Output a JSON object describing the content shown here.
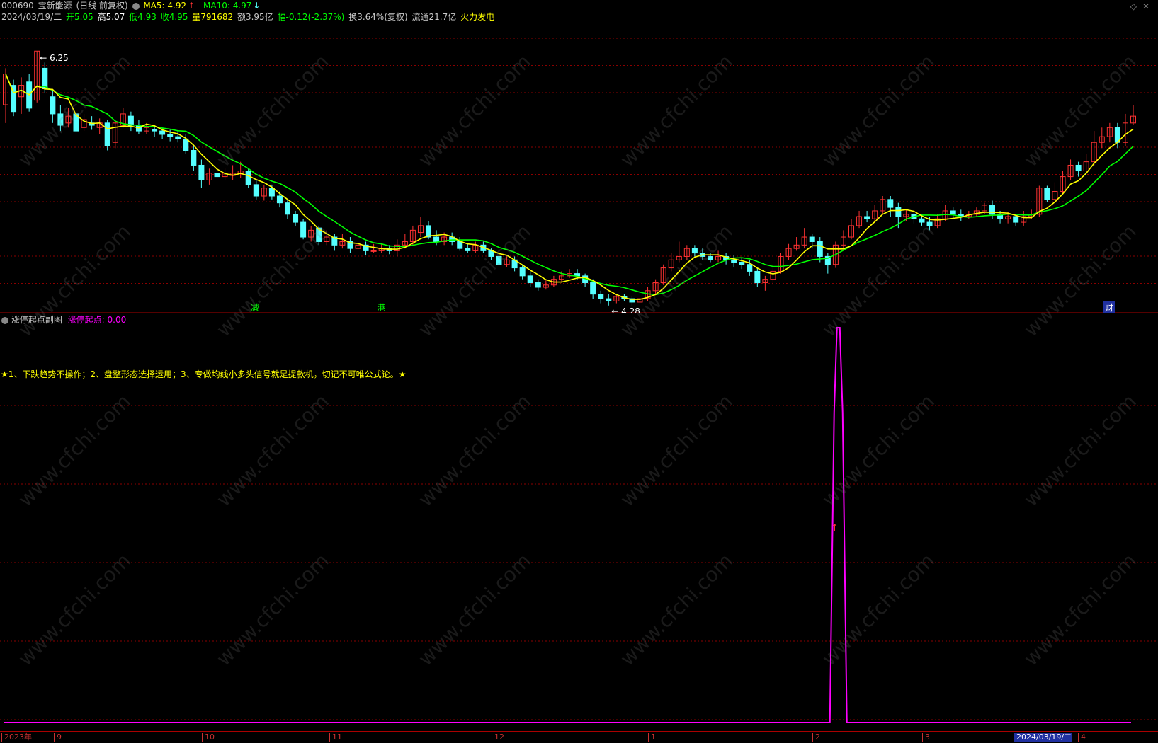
{
  "header": {
    "code": "000690",
    "name": "宝新能源",
    "mode": "(日线 前复权)",
    "ma5_label": "MA5: 4.92",
    "ma5_arrow": "↑",
    "ma10_label": "MA10: 4.97",
    "ma10_arrow": "↓"
  },
  "info": {
    "date": "2024/03/19/二",
    "open": "开5.05",
    "high": "高5.07",
    "low": "低4.93",
    "close": "收4.95",
    "volume": "量791682",
    "amount": "额3.95亿",
    "change": "幅-0.12(-2.37%)",
    "turnover": "换3.64%(复权)",
    "float": "流通21.7亿",
    "sector": "火力发电"
  },
  "main": {
    "high_label": "6.25",
    "low_label": "4.28",
    "markers": [
      "减",
      "港",
      "财"
    ]
  },
  "sub": {
    "name": "涨停起点副图",
    "indicator": "涨停起点: 0.00",
    "note": "★1、下跌趋势不操作；2、盘整形态选择运用；3、专做均线小多头信号就是提款机，切记不可唯公式论。★",
    "signal_arrow": "↑"
  },
  "axis": {
    "labels": [
      "2023年",
      "9",
      "10",
      "11",
      "12",
      "1",
      "2",
      "3",
      "2024/03/19/二",
      "4"
    ]
  },
  "watermark": "www.cfchi.com",
  "colors": {
    "up": "#ff3232",
    "down": "#54ffff",
    "ma5": "#ffff00",
    "ma10": "#00ff00",
    "indicator": "#ff00ff",
    "grid": "#8b0000"
  },
  "chart_data": {
    "type": "candlestick",
    "title": "000690 宝新能源 (日线 前复权)",
    "ylim": [
      4.0,
      6.45
    ],
    "candles": [
      [
        5.78,
        6.05,
        6.1,
        5.62
      ],
      [
        5.95,
        5.72,
        6.0,
        5.68
      ],
      [
        5.85,
        5.95,
        6.02,
        5.7
      ],
      [
        5.98,
        5.75,
        6.05,
        5.72
      ],
      [
        5.82,
        6.25,
        6.25,
        5.8
      ],
      [
        6.1,
        5.92,
        6.15,
        5.88
      ],
      [
        5.85,
        5.7,
        5.9,
        5.62
      ],
      [
        5.7,
        5.6,
        5.78,
        5.55
      ],
      [
        5.62,
        5.68,
        5.75,
        5.58
      ],
      [
        5.7,
        5.55,
        5.72,
        5.52
      ],
      [
        5.58,
        5.65,
        5.7,
        5.55
      ],
      [
        5.62,
        5.6,
        5.68,
        5.56
      ],
      [
        5.58,
        5.62,
        5.66,
        5.52
      ],
      [
        5.62,
        5.42,
        5.65,
        5.38
      ],
      [
        5.45,
        5.62,
        5.65,
        5.4
      ],
      [
        5.6,
        5.7,
        5.75,
        5.58
      ],
      [
        5.68,
        5.6,
        5.72,
        5.55
      ],
      [
        5.6,
        5.55,
        5.65,
        5.52
      ],
      [
        5.55,
        5.58,
        5.62,
        5.52
      ],
      [
        5.56,
        5.55,
        5.6,
        5.5
      ],
      [
        5.55,
        5.52,
        5.58,
        5.48
      ],
      [
        5.52,
        5.5,
        5.56,
        5.46
      ],
      [
        5.5,
        5.48,
        5.55,
        5.45
      ],
      [
        5.48,
        5.38,
        5.52,
        5.35
      ],
      [
        5.38,
        5.25,
        5.42,
        5.2
      ],
      [
        5.25,
        5.12,
        5.3,
        5.05
      ],
      [
        5.12,
        5.18,
        5.22,
        5.08
      ],
      [
        5.18,
        5.15,
        5.22,
        5.12
      ],
      [
        5.15,
        5.18,
        5.22,
        5.12
      ],
      [
        5.16,
        5.18,
        5.25,
        5.12
      ],
      [
        5.18,
        5.2,
        5.28,
        5.14
      ],
      [
        5.2,
        5.08,
        5.22,
        5.05
      ],
      [
        5.08,
        4.98,
        5.12,
        4.95
      ],
      [
        4.98,
        5.05,
        5.08,
        4.94
      ],
      [
        5.05,
        4.98,
        5.08,
        4.95
      ],
      [
        4.98,
        4.92,
        5.02,
        4.88
      ],
      [
        4.92,
        4.82,
        4.95,
        4.78
      ],
      [
        4.82,
        4.75,
        4.85,
        4.72
      ],
      [
        4.75,
        4.62,
        4.78,
        4.6
      ],
      [
        4.62,
        4.68,
        4.72,
        4.58
      ],
      [
        4.7,
        4.58,
        4.72,
        4.55
      ],
      [
        4.58,
        4.62,
        4.68,
        4.55
      ],
      [
        4.62,
        4.55,
        4.65,
        4.5
      ],
      [
        4.55,
        4.58,
        4.65,
        4.52
      ],
      [
        4.58,
        4.52,
        4.62,
        4.48
      ],
      [
        4.52,
        4.55,
        4.58,
        4.5
      ],
      [
        4.55,
        4.5,
        4.58,
        4.46
      ],
      [
        4.5,
        4.5,
        4.56,
        4.48
      ],
      [
        4.5,
        4.52,
        4.56,
        4.48
      ],
      [
        4.52,
        4.5,
        4.55,
        4.47
      ],
      [
        4.5,
        4.55,
        4.6,
        4.45
      ],
      [
        4.55,
        4.58,
        4.65,
        4.52
      ],
      [
        4.58,
        4.68,
        4.72,
        4.55
      ],
      [
        4.66,
        4.72,
        4.8,
        4.62
      ],
      [
        4.72,
        4.62,
        4.76,
        4.6
      ],
      [
        4.62,
        4.58,
        4.68,
        4.55
      ],
      [
        4.58,
        4.62,
        4.66,
        4.55
      ],
      [
        4.62,
        4.58,
        4.66,
        4.55
      ],
      [
        4.58,
        4.52,
        4.62,
        4.5
      ],
      [
        4.52,
        4.5,
        4.56,
        4.48
      ],
      [
        4.5,
        4.55,
        4.58,
        4.48
      ],
      [
        4.55,
        4.5,
        4.58,
        4.48
      ],
      [
        4.5,
        4.45,
        4.52,
        4.42
      ],
      [
        4.45,
        4.38,
        4.48,
        4.32
      ],
      [
        4.38,
        4.42,
        4.45,
        4.36
      ],
      [
        4.42,
        4.35,
        4.45,
        4.32
      ],
      [
        4.35,
        4.28,
        4.38,
        4.25
      ],
      [
        4.28,
        4.22,
        4.32,
        4.18
      ],
      [
        4.22,
        4.18,
        4.25,
        4.15
      ],
      [
        4.18,
        4.2,
        4.24,
        4.16
      ],
      [
        4.2,
        4.25,
        4.28,
        4.18
      ],
      [
        4.25,
        4.28,
        4.32,
        4.22
      ],
      [
        4.28,
        4.3,
        4.34,
        4.26
      ],
      [
        4.3,
        4.28,
        4.34,
        4.25
      ],
      [
        4.28,
        4.22,
        4.3,
        4.18
      ],
      [
        4.22,
        4.12,
        4.25,
        4.08
      ],
      [
        4.12,
        4.08,
        4.15,
        4.04
      ],
      [
        4.08,
        4.06,
        4.12,
        4.02
      ],
      [
        4.06,
        4.1,
        4.12,
        4.04
      ],
      [
        4.1,
        4.08,
        4.12,
        4.06
      ],
      [
        4.08,
        4.05,
        4.1,
        4.02
      ],
      [
        4.05,
        4.08,
        4.12,
        4.03
      ],
      [
        4.08,
        4.15,
        4.18,
        4.06
      ],
      [
        4.15,
        4.22,
        4.25,
        4.12
      ],
      [
        4.22,
        4.35,
        4.38,
        4.2
      ],
      [
        4.35,
        4.42,
        4.48,
        4.32
      ],
      [
        4.42,
        4.45,
        4.58,
        4.4
      ],
      [
        4.45,
        4.52,
        4.55,
        4.42
      ],
      [
        4.52,
        4.48,
        4.55,
        4.45
      ],
      [
        4.48,
        4.45,
        4.52,
        4.42
      ],
      [
        4.45,
        4.42,
        4.48,
        4.4
      ],
      [
        4.42,
        4.45,
        4.5,
        4.4
      ],
      [
        4.45,
        4.42,
        4.48,
        4.38
      ],
      [
        4.42,
        4.4,
        4.46,
        4.36
      ],
      [
        4.4,
        4.38,
        4.44,
        4.34
      ],
      [
        4.38,
        4.32,
        4.42,
        4.28
      ],
      [
        4.32,
        4.22,
        4.35,
        4.18
      ],
      [
        4.22,
        4.25,
        4.28,
        4.15
      ],
      [
        4.25,
        4.32,
        4.35,
        4.2
      ],
      [
        4.32,
        4.45,
        4.48,
        4.3
      ],
      [
        4.45,
        4.52,
        4.56,
        4.42
      ],
      [
        4.52,
        4.55,
        4.62,
        4.5
      ],
      [
        4.55,
        4.62,
        4.7,
        4.52
      ],
      [
        4.62,
        4.58,
        4.65,
        4.52
      ],
      [
        4.58,
        4.45,
        4.62,
        4.4
      ],
      [
        4.45,
        4.38,
        4.48,
        4.3
      ],
      [
        4.38,
        4.55,
        4.58,
        4.35
      ],
      [
        4.55,
        4.62,
        4.68,
        4.52
      ],
      [
        4.62,
        4.72,
        4.78,
        4.6
      ],
      [
        4.72,
        4.8,
        4.85,
        4.7
      ],
      [
        4.8,
        4.78,
        4.85,
        4.75
      ],
      [
        4.78,
        4.85,
        4.9,
        4.76
      ],
      [
        4.85,
        4.95,
        4.98,
        4.82
      ],
      [
        4.95,
        4.88,
        4.98,
        4.8
      ],
      [
        4.88,
        4.8,
        4.92,
        4.7
      ],
      [
        4.8,
        4.82,
        4.86,
        4.76
      ],
      [
        4.82,
        4.78,
        4.85,
        4.74
      ],
      [
        4.78,
        4.75,
        4.82,
        4.72
      ],
      [
        4.75,
        4.72,
        4.8,
        4.68
      ],
      [
        4.72,
        4.78,
        4.82,
        4.7
      ],
      [
        4.78,
        4.85,
        4.9,
        4.76
      ],
      [
        4.85,
        4.82,
        4.88,
        4.78
      ],
      [
        4.82,
        4.8,
        4.86,
        4.76
      ],
      [
        4.8,
        4.82,
        4.85,
        4.78
      ],
      [
        4.82,
        4.85,
        4.88,
        4.8
      ],
      [
        4.85,
        4.9,
        4.92,
        4.82
      ],
      [
        4.9,
        4.82,
        4.94,
        4.78
      ],
      [
        4.82,
        4.78,
        4.85,
        4.74
      ],
      [
        4.78,
        4.8,
        4.84,
        4.74
      ],
      [
        4.8,
        4.75,
        4.82,
        4.72
      ],
      [
        4.75,
        4.8,
        4.85,
        4.72
      ],
      [
        4.8,
        4.82,
        4.86,
        4.78
      ],
      [
        4.82,
        5.05,
        5.07,
        4.8
      ],
      [
        5.05,
        4.95,
        5.07,
        4.93
      ],
      [
        4.95,
        5.02,
        5.1,
        4.92
      ],
      [
        5.02,
        5.15,
        5.2,
        5.0
      ],
      [
        5.15,
        5.25,
        5.3,
        5.12
      ],
      [
        5.25,
        5.2,
        5.28,
        5.15
      ],
      [
        5.2,
        5.28,
        5.35,
        5.18
      ],
      [
        5.28,
        5.45,
        5.55,
        5.25
      ],
      [
        5.45,
        5.5,
        5.58,
        5.4
      ],
      [
        5.5,
        5.58,
        5.62,
        5.45
      ],
      [
        5.58,
        5.45,
        5.62,
        5.4
      ],
      [
        5.45,
        5.62,
        5.7,
        5.42
      ],
      [
        5.62,
        5.68,
        5.78,
        5.6
      ]
    ],
    "ma5_shown": 4.92,
    "ma10_shown": 4.97,
    "annotations": [
      {
        "text": "6.25",
        "type": "high"
      },
      {
        "text": "4.28",
        "type": "low"
      }
    ],
    "sub_indicator": {
      "name": "涨停起点",
      "baseline": 0,
      "peak": 1,
      "peak_position_fraction": 0.724
    }
  }
}
